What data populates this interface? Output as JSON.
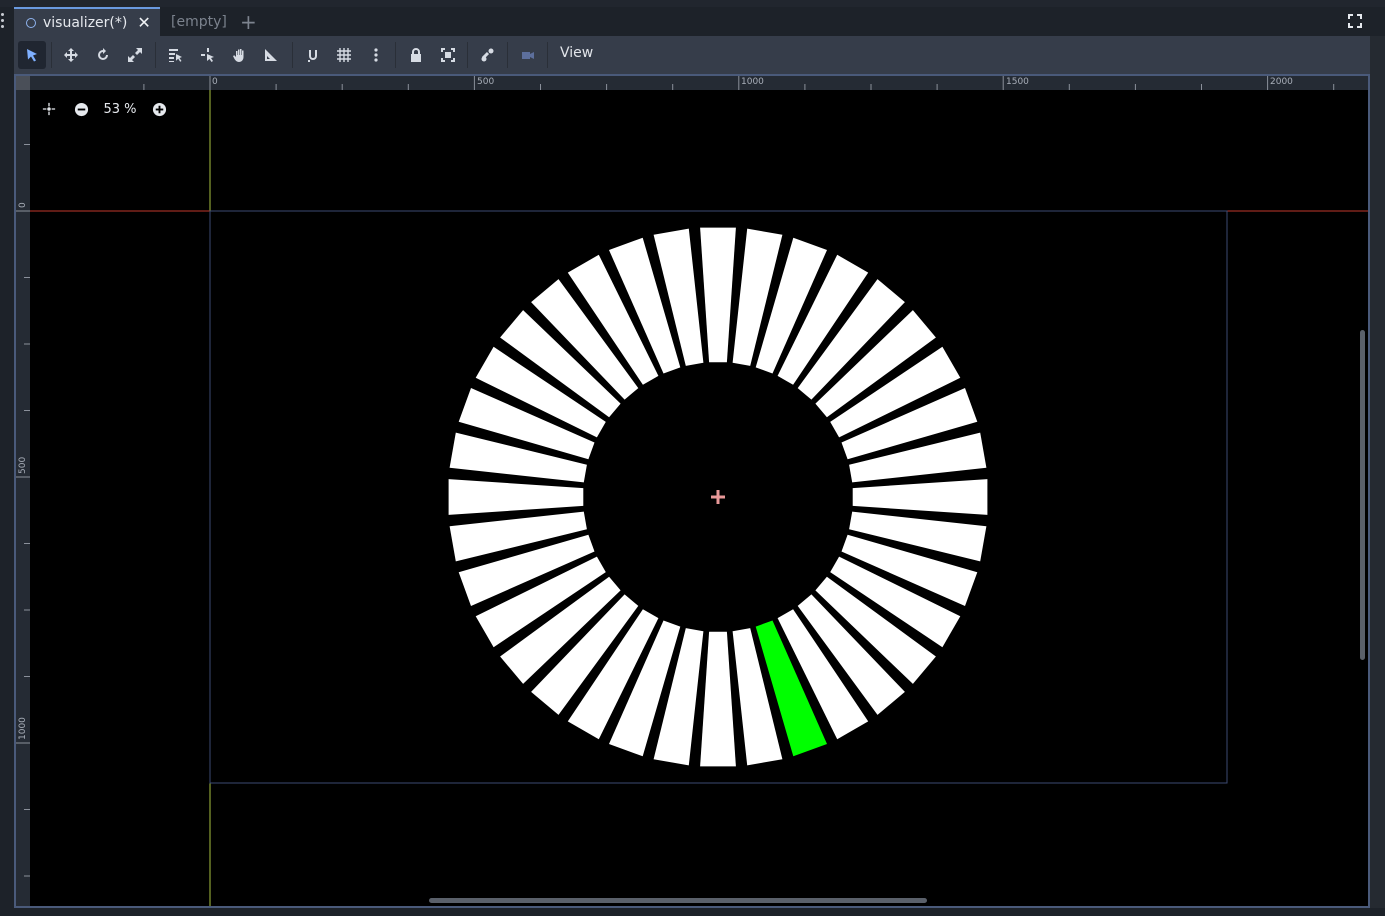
{
  "tabs": [
    {
      "label": "visualizer(*)",
      "active": true
    },
    {
      "label": "[empty]",
      "active": false
    }
  ],
  "toolbar": {
    "tools": [
      "select-mode-icon",
      "move-mode-icon",
      "rotate-mode-icon",
      "scale-mode-icon",
      "list-select-icon",
      "pivot-mode-icon",
      "pan-mode-icon",
      "ruler-mode-icon",
      "smart-snap-icon",
      "grid-snap-icon",
      "more-options-icon",
      "lock-icon",
      "group-icon",
      "bone-icon",
      "camera-icon"
    ],
    "view_label": "View"
  },
  "zoom": {
    "label": "53 %"
  },
  "rulers": {
    "top": [
      "0",
      "500",
      "1000",
      "1500",
      "2000"
    ],
    "left": [
      "0",
      "500",
      "1000"
    ]
  },
  "visualizer": {
    "bar_count": 36,
    "highlight_index": 2,
    "bar_color": "#ffffff",
    "highlight_color": "#00ff00"
  },
  "colors": {
    "accent": "#6a9ae0",
    "x_axis": "#c0392b",
    "y_axis": "#a8c240",
    "origin_marker": "#e89898"
  }
}
